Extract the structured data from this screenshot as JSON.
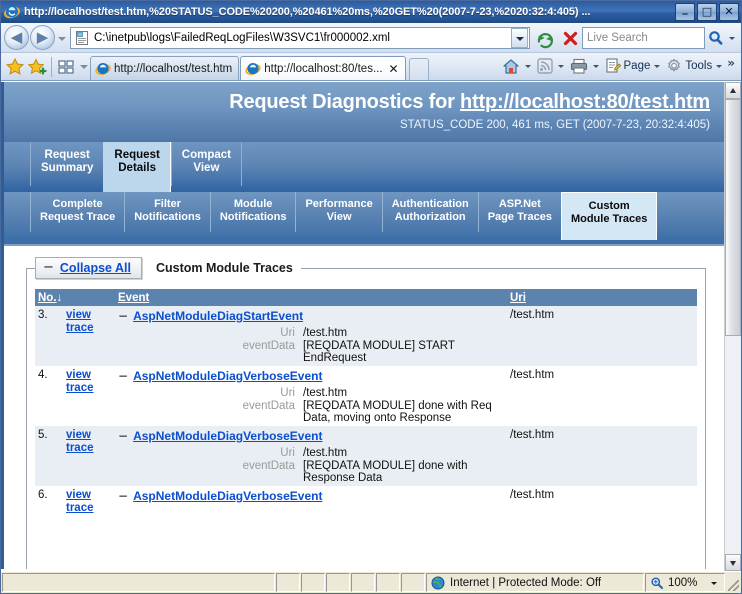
{
  "window": {
    "title": "http://localhost/test.htm,%20STATUS_CODE%20200,%20461%20ms,%20GET%20(2007-7-23,%2020:32:4:405) ...",
    "minimize_label": "_",
    "maximize_label": "□",
    "close_label": "✕"
  },
  "navbar": {
    "back_label": "◀",
    "forward_label": "▶",
    "address_value": "C:\\inetpub\\logs\\FailedReqLogFiles\\W3SVC1\\fr000002.xml",
    "refresh_name": "refresh-button",
    "stop_name": "stop-button",
    "search_placeholder": "Live Search"
  },
  "tabbar": {
    "tabs": [
      {
        "label": "http://localhost/test.htm",
        "active": false,
        "closable": false
      },
      {
        "label": "http://localhost:80/tes...",
        "active": true,
        "closable": true,
        "close_label": "✕"
      }
    ],
    "commands": [
      {
        "name": "home",
        "label": ""
      },
      {
        "name": "feeds",
        "label": ""
      },
      {
        "name": "print",
        "label": ""
      },
      {
        "name": "page",
        "label": "Page"
      },
      {
        "name": "tools",
        "label": "Tools"
      }
    ],
    "overflow_label": "»"
  },
  "page": {
    "header": {
      "title_prefix": "Request Diagnostics for ",
      "title_url": "http://localhost:80/test.htm",
      "subtitle": "STATUS_CODE 200, 461 ms, GET (2007-7-23, 20:32:4:405)"
    },
    "primary_tabs": [
      {
        "line1": "Request",
        "line2": "Summary",
        "active": false
      },
      {
        "line1": "Request",
        "line2": "Details",
        "active": true
      },
      {
        "line1": "Compact",
        "line2": "View",
        "active": false
      }
    ],
    "secondary_tabs": [
      {
        "line1": "Complete",
        "line2": "Request Trace",
        "active": false
      },
      {
        "line1": "Filter",
        "line2": "Notifications",
        "active": false
      },
      {
        "line1": "Module",
        "line2": "Notifications",
        "active": false
      },
      {
        "line1": "Performance",
        "line2": "View",
        "active": false
      },
      {
        "line1": "Authentication",
        "line2": "Authorization",
        "active": false
      },
      {
        "line1": "ASP.Net",
        "line2": "Page Traces",
        "active": false
      },
      {
        "line1": "Custom",
        "line2": "Module Traces",
        "active": true
      }
    ],
    "collapse_all": {
      "icon": "−",
      "label": "Collapse All"
    },
    "section_title": "Custom Module Traces",
    "table": {
      "columns": [
        "No.",
        "",
        "Event",
        "Uri"
      ],
      "sort_indicator": "↓",
      "view_trace_line1": "view",
      "view_trace_line2": "trace",
      "toggle_icon": "−",
      "rows": [
        {
          "no": "3.",
          "event": "AspNetModuleDiagStartEvent",
          "uri": "/test.htm",
          "details": [
            {
              "label": "Uri",
              "value": "/test.htm"
            },
            {
              "label": "eventData",
              "value": "[REQDATA MODULE] START EndRequest"
            }
          ]
        },
        {
          "no": "4.",
          "event": "AspNetModuleDiagVerboseEvent",
          "uri": "/test.htm",
          "details": [
            {
              "label": "Uri",
              "value": "/test.htm"
            },
            {
              "label": "eventData",
              "value": "[REQDATA MODULE] done with Req Data, moving onto Response"
            }
          ]
        },
        {
          "no": "5.",
          "event": "AspNetModuleDiagVerboseEvent",
          "uri": "/test.htm",
          "details": [
            {
              "label": "Uri",
              "value": "/test.htm"
            },
            {
              "label": "eventData",
              "value": "[REQDATA MODULE] done with Response Data"
            }
          ]
        },
        {
          "no": "6.",
          "event": "AspNetModuleDiagVerboseEvent",
          "uri": "/test.htm",
          "details": []
        }
      ]
    }
  },
  "statusbar": {
    "message": "",
    "zone": "Internet | Protected Mode: Off",
    "zoom": "100%"
  },
  "colors": {
    "accent_blue": "#5b83ad",
    "link_blue": "#0b4ecf",
    "header_gradient_top": "#7fa3c9",
    "header_gradient_bottom": "#4e77a8",
    "active_tab_bg": "#bcd7ec",
    "alt_row_bg": "#e8eef4",
    "title_bar": "#2d5c9e"
  }
}
